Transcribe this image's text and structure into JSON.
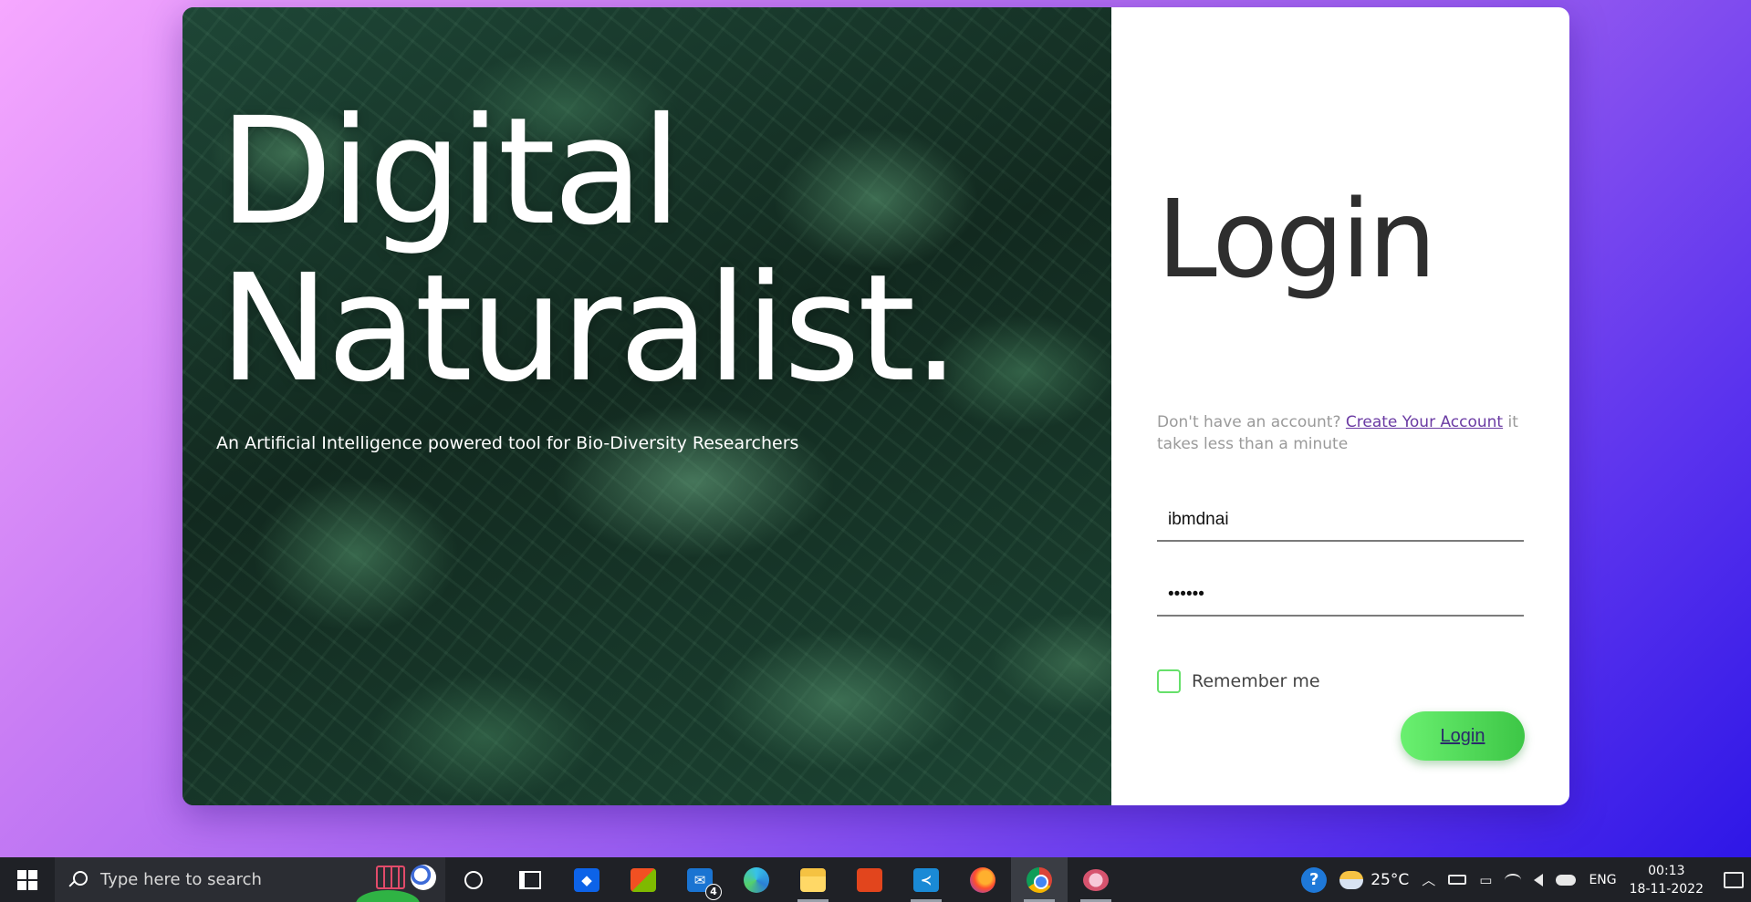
{
  "hero": {
    "title_line1": "Digital",
    "title_line2": "Naturalist.",
    "subtitle": "An Artificial Intelligence powered tool for Bio-Diversity Researchers"
  },
  "login": {
    "heading": "Login",
    "signup_prefix": "Don't have an account?",
    "signup_link": "Create Your Account",
    "signup_suffix": "it takes less than a minute",
    "username_value": "ibmdnai",
    "password_value": "••••••",
    "remember_label": "Remember me",
    "button_label": "Login"
  },
  "colors": {
    "button_green": "#4fd558",
    "checkbox_border": "#66e06a",
    "link_purple": "#6a3aa3",
    "taskbar_bg": "#1f2126"
  },
  "taskbar": {
    "search_placeholder": "Type here to search",
    "apps": [
      "cortana-icon",
      "task-view-icon",
      "dropbox-icon",
      "microsoft-store-icon",
      "mail-icon",
      "edge-icon",
      "file-explorer-icon",
      "office-icon",
      "vscode-icon",
      "firefox-icon",
      "chrome-icon",
      "snipping-tool-icon"
    ],
    "mail_badge": "4",
    "temperature": "25°C",
    "language": "ENG",
    "time": "00:13",
    "date": "18-11-2022"
  }
}
